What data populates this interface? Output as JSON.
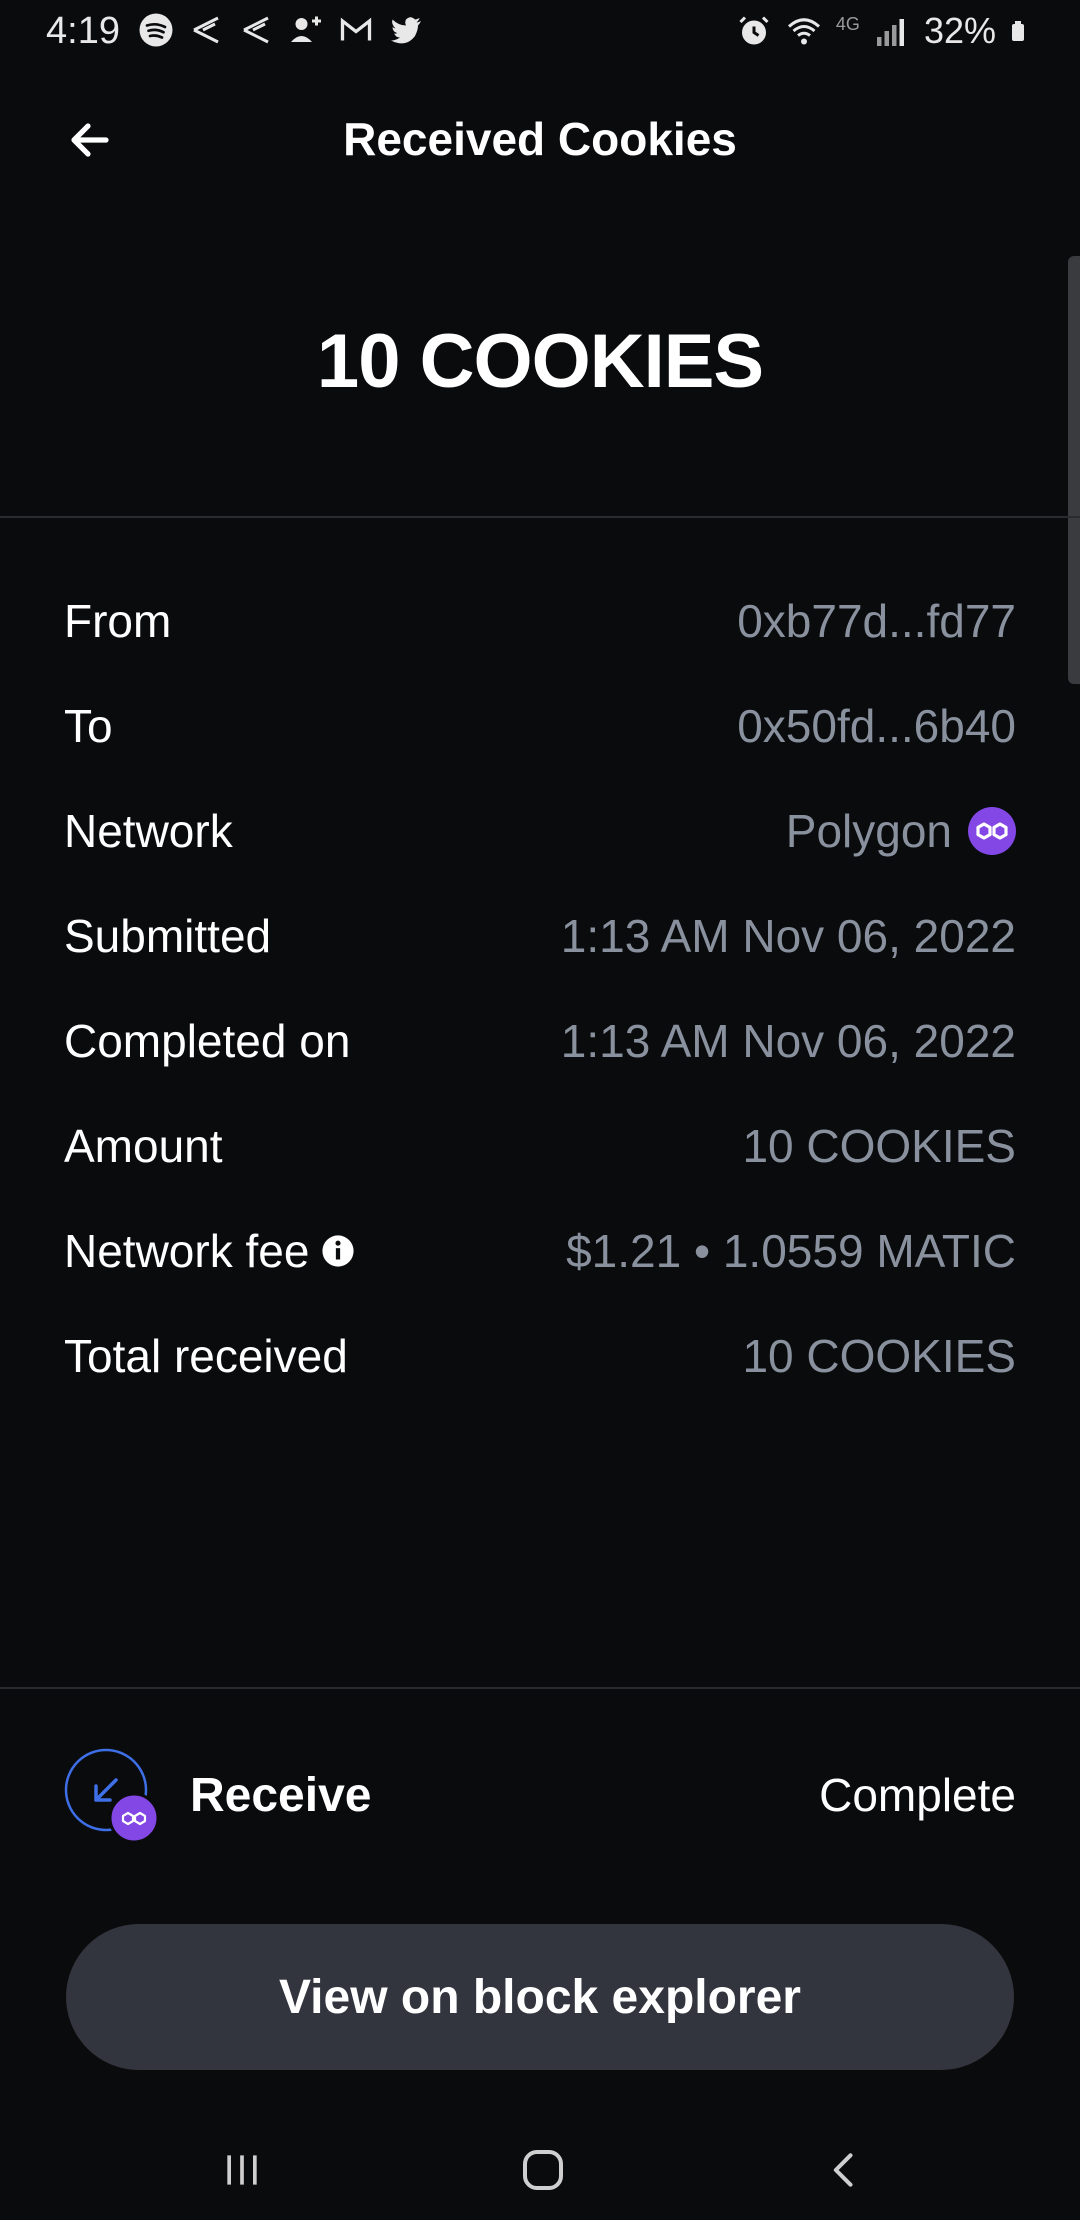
{
  "status_bar": {
    "time": "4:19",
    "network_label": "4G",
    "battery": "32%",
    "icons_left": [
      "spotify-icon",
      "app-icon",
      "app-icon",
      "add-contact-icon",
      "gmail-icon",
      "twitter-icon"
    ],
    "icons_right": [
      "alarm-icon",
      "wifi-icon",
      "signal-icon",
      "battery-icon"
    ]
  },
  "header": {
    "title": "Received Cookies"
  },
  "hero": {
    "amount": "10 COOKIES"
  },
  "details": [
    {
      "label": "From",
      "value": "0xb77d...fd77"
    },
    {
      "label": "To",
      "value": "0x50fd...6b40"
    },
    {
      "label": "Network",
      "value": "Polygon"
    },
    {
      "label": "Submitted",
      "value": "1:13 AM Nov 06, 2022"
    },
    {
      "label": "Completed on",
      "value": "1:13 AM Nov 06, 2022"
    },
    {
      "label": "Amount",
      "value": "10 COOKIES"
    },
    {
      "label": "Network fee",
      "value": "$1.21 • 1.0559 MATIC"
    },
    {
      "label": "Total received",
      "value": "10 COOKIES"
    }
  ],
  "transaction": {
    "type": "Receive",
    "status": "Complete"
  },
  "actions": {
    "explorer_label": "View on block explorer"
  },
  "colors": {
    "background": "#0a0b0d",
    "muted_text": "#8a919e",
    "button_bg": "#32353d",
    "polygon_purple": "#8247e5",
    "receive_blue": "#3e6fe6"
  }
}
